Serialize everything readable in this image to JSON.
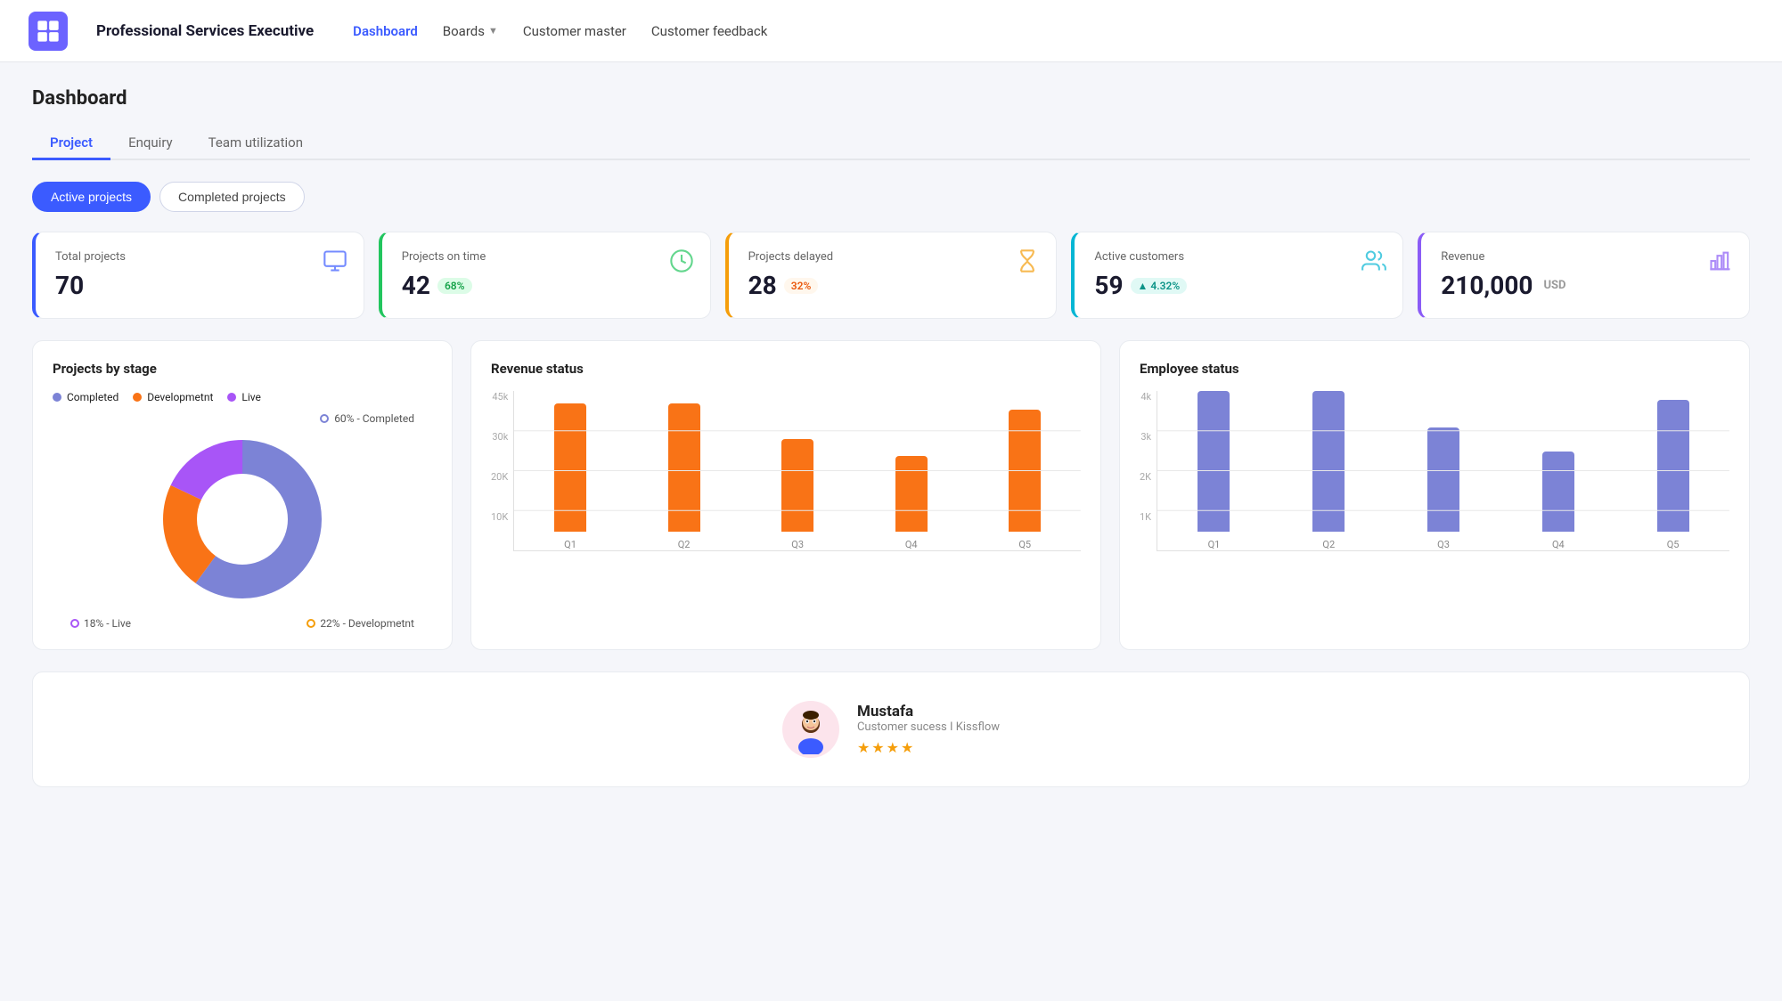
{
  "header": {
    "app_title": "Professional Services Executive",
    "logo_icon": "grid-icon",
    "nav": [
      {
        "label": "Dashboard",
        "active": true,
        "has_dropdown": false
      },
      {
        "label": "Boards",
        "active": false,
        "has_dropdown": true
      },
      {
        "label": "Customer master",
        "active": false,
        "has_dropdown": false
      },
      {
        "label": "Customer feedback",
        "active": false,
        "has_dropdown": false
      }
    ]
  },
  "page": {
    "title": "Dashboard",
    "tabs": [
      {
        "label": "Project",
        "active": true
      },
      {
        "label": "Enquiry",
        "active": false
      },
      {
        "label": "Team utilization",
        "active": false
      }
    ],
    "filters": [
      {
        "label": "Active projects",
        "active": true
      },
      {
        "label": "Completed projects",
        "active": false
      }
    ]
  },
  "kpis": [
    {
      "label": "Total projects",
      "value": "70",
      "badge": null,
      "sub": null,
      "border": "left-blue"
    },
    {
      "label": "Projects on time",
      "value": "42",
      "badge": "68%",
      "badge_type": "green",
      "sub": null,
      "border": "left-green"
    },
    {
      "label": "Projects delayed",
      "value": "28",
      "badge": "32%",
      "badge_type": "orange",
      "sub": null,
      "border": "left-yellow"
    },
    {
      "label": "Active customers",
      "value": "59",
      "badge": "▲ 4.32%",
      "badge_type": "teal",
      "sub": null,
      "border": "left-teal"
    },
    {
      "label": "Revenue",
      "value": "210,000",
      "sub": "USD",
      "badge": null,
      "border": "left-purple"
    }
  ],
  "charts": {
    "donut": {
      "title": "Projects by stage",
      "legend": [
        {
          "label": "Completed",
          "color": "#7c83d6"
        },
        {
          "label": "Developmetnt",
          "color": "#f97316"
        },
        {
          "label": "Live",
          "color": "#a855f7"
        }
      ],
      "segments": [
        {
          "label": "Completed",
          "pct": 60,
          "color": "#7c83d6"
        },
        {
          "label": "Developmetnt",
          "pct": 22,
          "color": "#f97316"
        },
        {
          "label": "Live",
          "pct": 18,
          "color": "#a855f7"
        }
      ],
      "annotations": [
        {
          "text": "60% - Completed",
          "color": "#7c83d6"
        },
        {
          "text": "18% - Live",
          "color": "#a855f7"
        },
        {
          "text": "22% - Developmetnt",
          "color": "#f97316"
        }
      ]
    },
    "revenue": {
      "title": "Revenue status",
      "y_labels": [
        "45k",
        "30k",
        "20K",
        "10K",
        ""
      ],
      "bars": [
        {
          "label": "Q1",
          "height_pct": 80
        },
        {
          "label": "Q2",
          "height_pct": 80
        },
        {
          "label": "Q3",
          "height_pct": 58
        },
        {
          "label": "Q4",
          "height_pct": 47
        },
        {
          "label": "Q5",
          "height_pct": 76
        }
      ]
    },
    "employee": {
      "title": "Employee status",
      "y_labels": [
        "4k",
        "3k",
        "2K",
        "1K",
        ""
      ],
      "bars": [
        {
          "label": "Q1",
          "height_pct": 88
        },
        {
          "label": "Q2",
          "height_pct": 88
        },
        {
          "label": "Q3",
          "height_pct": 65
        },
        {
          "label": "Q4",
          "height_pct": 50
        },
        {
          "label": "Q5",
          "height_pct": 82
        }
      ]
    }
  },
  "testimonial": {
    "name": "Mustafa",
    "role": "Customer sucess I Kissflow",
    "stars": "★★★★",
    "avatar_emoji": "🧑"
  }
}
